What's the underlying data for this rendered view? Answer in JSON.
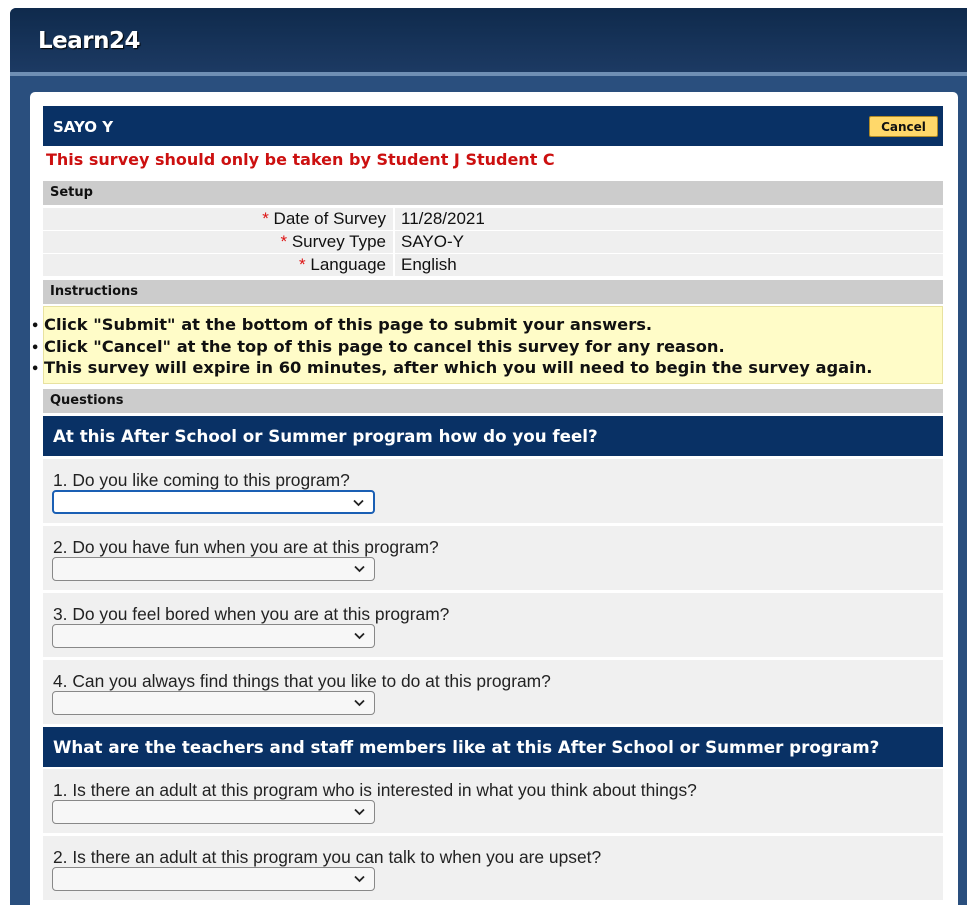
{
  "app": {
    "title": "Learn24"
  },
  "survey": {
    "title": "SAYO Y",
    "cancel_label": "Cancel",
    "warning": "This survey should only be taken by Student J Student C"
  },
  "setup": {
    "heading": "Setup",
    "fields": [
      {
        "label": "Date of Survey",
        "value": "11/28/2021",
        "required_marker": "*"
      },
      {
        "label": "Survey Type",
        "value": "SAYO-Y",
        "required_marker": "*"
      },
      {
        "label": "Language",
        "value": "English",
        "required_marker": "*"
      }
    ]
  },
  "instructions": {
    "heading": "Instructions",
    "items": [
      "Click \"Submit\" at the bottom of this page to submit your answers.",
      "Click \"Cancel\" at the top of this page to cancel this survey for any reason.",
      "This survey will expire in 60 minutes, after which you will need to begin the survey again."
    ],
    "bullet": "•"
  },
  "questions": {
    "heading": "Questions",
    "sections": [
      {
        "title": "At this After School or Summer program how do you feel?",
        "items": [
          {
            "text": "1. Do you like coming to this program?",
            "selected": ""
          },
          {
            "text": "2. Do you have fun when you are at this program?",
            "selected": ""
          },
          {
            "text": "3. Do you feel bored when you are at this program?",
            "selected": ""
          },
          {
            "text": "4. Can you always find things that you like to do at this program?",
            "selected": ""
          }
        ]
      },
      {
        "title": "What are the teachers and staff members like at this After School or Summer program?",
        "items": [
          {
            "text": "1. Is there an adult at this program who is interested in what you think about things?",
            "selected": ""
          },
          {
            "text": "2. Is there an adult at this program you can talk to when you are upset?",
            "selected": ""
          }
        ]
      }
    ]
  },
  "colors": {
    "navy": "#093165",
    "warning_red": "#cc1010",
    "cancel_yellow": "#ffd86a",
    "instructions_bg": "#fffcc8",
    "section_gray": "#cccccc"
  }
}
